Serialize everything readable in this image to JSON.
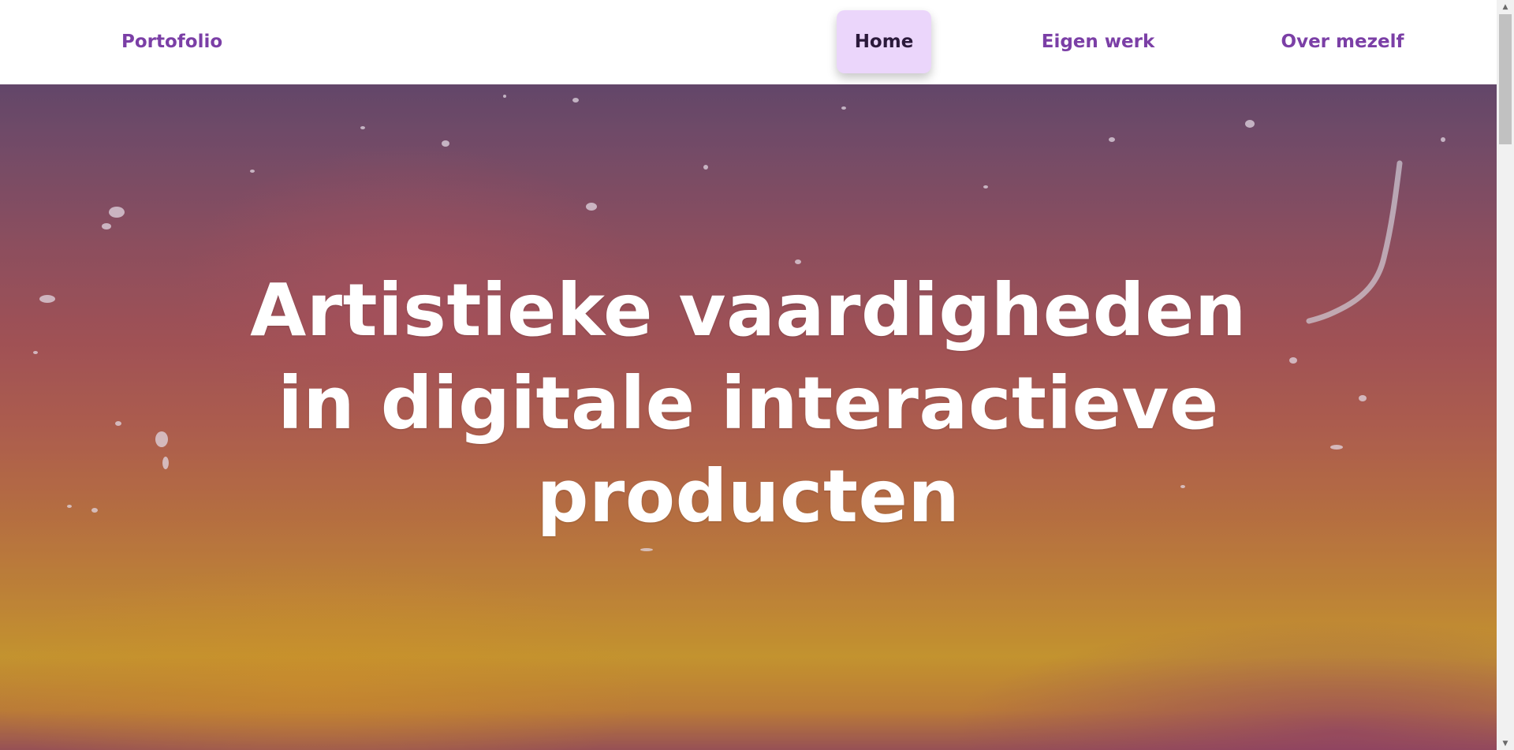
{
  "nav": {
    "brand": "Portofolio",
    "items": [
      {
        "label": "Home",
        "active": true
      },
      {
        "label": "Eigen werk",
        "active": false
      },
      {
        "label": "Over mezelf",
        "active": false
      }
    ]
  },
  "hero": {
    "title": "Artistieke vaardigheden in digitale interactieve producten",
    "background_image": "watercolor-sunset-texture"
  },
  "colors": {
    "brand": "#7b3fa6",
    "active_nav_bg": "#ebd6fb",
    "active_nav_text": "#2b1a3b",
    "hero_text": "#ffffff"
  },
  "scrollbar": {
    "up_icon": "scroll-up-arrow-icon",
    "down_icon": "scroll-down-arrow-icon"
  }
}
